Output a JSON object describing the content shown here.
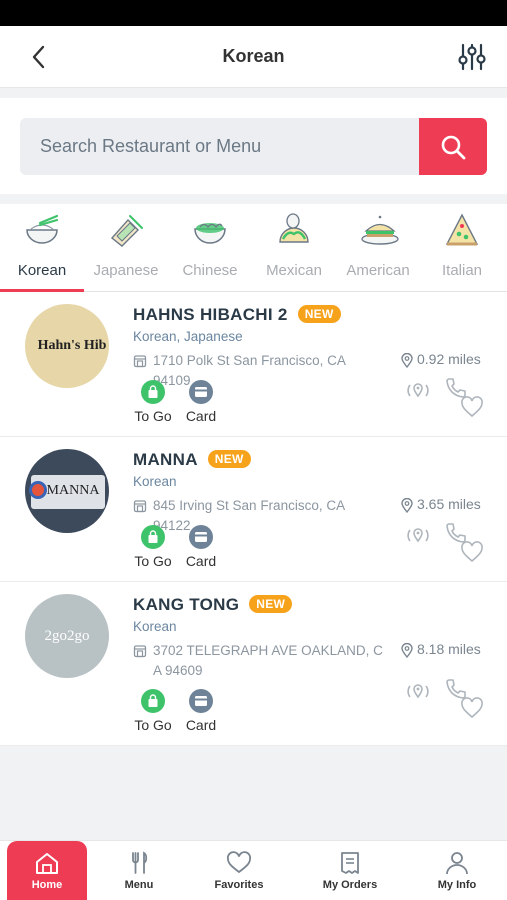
{
  "header": {
    "title": "Korean"
  },
  "search": {
    "placeholder": "Search Restaurant or Menu"
  },
  "categories": [
    {
      "label": "Korean",
      "icon": "rice-bowl-icon",
      "active": true
    },
    {
      "label": "Japanese",
      "icon": "sushi-icon"
    },
    {
      "label": "Chinese",
      "icon": "noodle-bowl-icon"
    },
    {
      "label": "Mexican",
      "icon": "taco-icon"
    },
    {
      "label": "American",
      "icon": "burger-plate-icon"
    },
    {
      "label": "Italian",
      "icon": "pizza-slice-icon"
    }
  ],
  "restaurants": [
    {
      "name": "HAHNS HIBACHI 2",
      "badge": "NEW",
      "cuisine": "Korean, Japanese",
      "address": "1710 Polk St San Francisco, CA 94109",
      "distance": "0.92 miles",
      "logo_text": "Hahn's Hib",
      "options": [
        "To Go",
        "Card"
      ]
    },
    {
      "name": "MANNA",
      "badge": "NEW",
      "cuisine": "Korean",
      "address": "845 Irving St San Francisco, CA 94122",
      "distance": "3.65 miles",
      "logo_text": "MANNA",
      "options": [
        "To Go",
        "Card"
      ]
    },
    {
      "name": "KANG TONG",
      "badge": "NEW",
      "cuisine": "Korean",
      "address": "3702 TELEGRAPH AVE OAKLAND, CA 94609",
      "distance": "8.18 miles",
      "logo_text": "2go2go",
      "options": [
        "To Go",
        "Card"
      ]
    }
  ],
  "tabs": [
    {
      "label": "Home",
      "active": true
    },
    {
      "label": "Menu"
    },
    {
      "label": "Favorites"
    },
    {
      "label": "My Orders"
    },
    {
      "label": "My Info"
    }
  ],
  "colors": {
    "accent": "#ee3c55",
    "badge": "#f7a21b",
    "togo": "#3ec36b",
    "card": "#6e8397"
  }
}
